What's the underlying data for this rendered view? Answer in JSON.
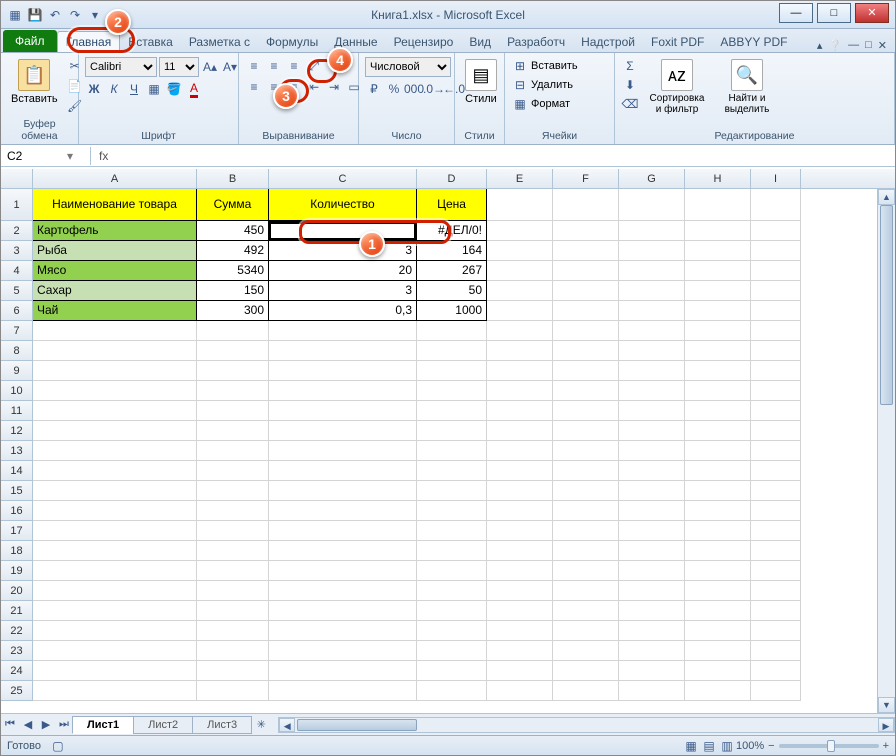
{
  "title": "Книга1.xlsx - Microsoft Excel",
  "qat": {
    "save": "💾",
    "undo": "↶",
    "redo": "↷"
  },
  "tabs": {
    "file": "Файл",
    "items": [
      "Главная",
      "Вставка",
      "Разметка с",
      "Формулы",
      "Данные",
      "Рецензиро",
      "Вид",
      "Разработч",
      "Надстрой",
      "Foxit PDF",
      "ABBYY PDF"
    ],
    "active_index": 0
  },
  "ribbon": {
    "clipboard": {
      "label": "Буфер обмена",
      "paste": "Вставить"
    },
    "font": {
      "label": "Шрифт",
      "name": "Calibri",
      "size": "11"
    },
    "alignment": {
      "label": "Выравнивание"
    },
    "number": {
      "label": "Число",
      "format": "Числовой"
    },
    "styles": {
      "label": "Стили",
      "btn": "Стили"
    },
    "cells": {
      "label": "Ячейки",
      "insert": "Вставить",
      "delete": "Удалить",
      "format": "Формат"
    },
    "editing": {
      "label": "Редактирование",
      "sort": "Сортировка и фильтр",
      "find": "Найти и выделить"
    }
  },
  "namebox": "C2",
  "fx_label": "fx",
  "columns": [
    "A",
    "B",
    "C",
    "D",
    "E",
    "F",
    "G",
    "H",
    "I"
  ],
  "header_row": [
    "Наименование товара",
    "Сумма",
    "Количество",
    "Цена"
  ],
  "data_rows": [
    {
      "name": "Картофель",
      "sum": "450",
      "qty": "",
      "price": "#ДЕЛ/0!"
    },
    {
      "name": "Рыба",
      "sum": "492",
      "qty": "3",
      "price": "164"
    },
    {
      "name": "Мясо",
      "sum": "5340",
      "qty": "20",
      "price": "267"
    },
    {
      "name": "Сахар",
      "sum": "150",
      "qty": "3",
      "price": "50"
    },
    {
      "name": "Чай",
      "sum": "300",
      "qty": "0,3",
      "price": "1000"
    }
  ],
  "sheets": {
    "items": [
      "Лист1",
      "Лист2",
      "Лист3"
    ],
    "active": 0
  },
  "status": {
    "ready": "Готово",
    "zoom": "100%"
  },
  "callouts": {
    "1": "1",
    "2": "2",
    "3": "3",
    "4": "4"
  }
}
